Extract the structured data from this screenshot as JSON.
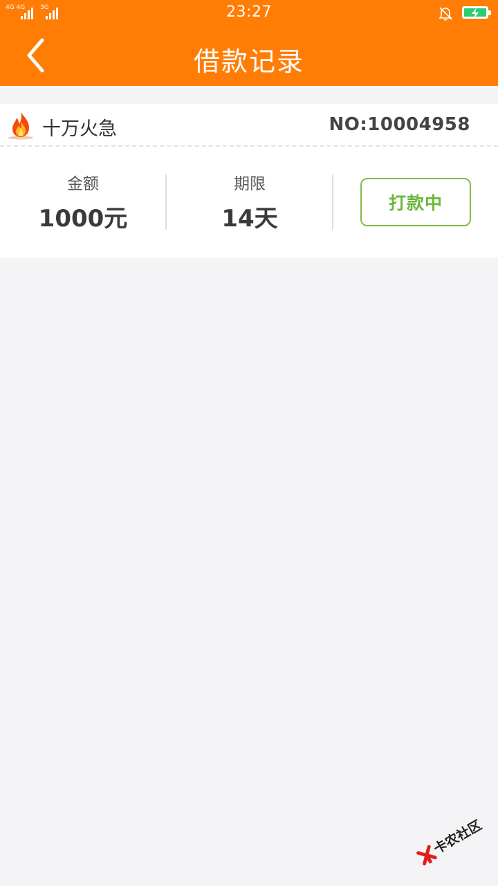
{
  "status_bar": {
    "sim1_label": "4G 4G",
    "sim2_label": "3G",
    "time": "23:27"
  },
  "header": {
    "title": "借款记录",
    "accent_color": "#ff7d05"
  },
  "record": {
    "product_name": "十万火急",
    "order_no": "NO:10004958",
    "amount_label": "金额",
    "amount_value": "1000元",
    "term_label": "期限",
    "term_value": "14天",
    "status": "打款中",
    "status_color": "#6ab73a"
  },
  "watermark": {
    "text": "卡农社区"
  }
}
